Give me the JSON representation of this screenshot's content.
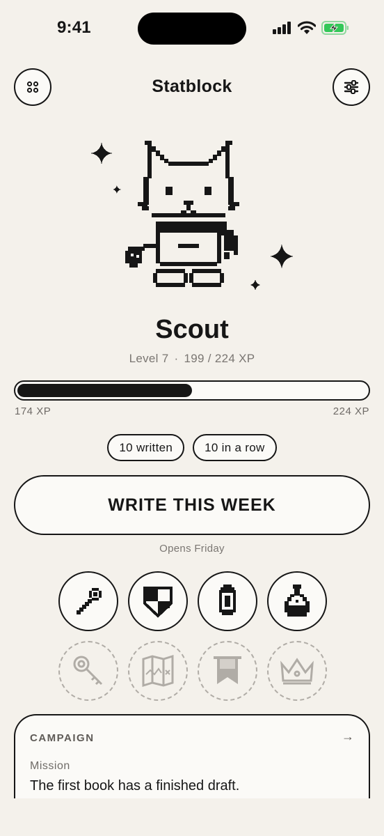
{
  "status_bar": {
    "time": "9:41",
    "battery_color": "#34c759"
  },
  "header": {
    "title": "Statblock",
    "menu_icon": "grid-dots-icon",
    "settings_icon": "sliders-icon"
  },
  "pet": {
    "name": "Scout",
    "level_text": "Level 7",
    "xp_text": "199 / 224 XP",
    "illustration": "pixel-cat-with-scarf"
  },
  "xp_bar": {
    "min_label": "174 XP",
    "max_label": "224 XP",
    "progress": 0.5
  },
  "stats": {
    "written": "10 written",
    "streak": "10 in a row"
  },
  "action": {
    "write_label": "WRITE THIS WEEK",
    "opens_note": "Opens Friday"
  },
  "badges": {
    "earned": [
      {
        "name": "wrench-badge-icon"
      },
      {
        "name": "shield-badge-icon"
      },
      {
        "name": "lantern-badge-icon"
      },
      {
        "name": "potion-badge-icon"
      }
    ],
    "locked": [
      {
        "name": "key-badge-icon"
      },
      {
        "name": "map-badge-icon"
      },
      {
        "name": "banner-badge-icon"
      },
      {
        "name": "crown-badge-icon"
      }
    ]
  },
  "campaign": {
    "label": "CAMPAIGN",
    "arrow": "→",
    "mission_label": "Mission",
    "mission_text": "The first book has a finished draft."
  }
}
